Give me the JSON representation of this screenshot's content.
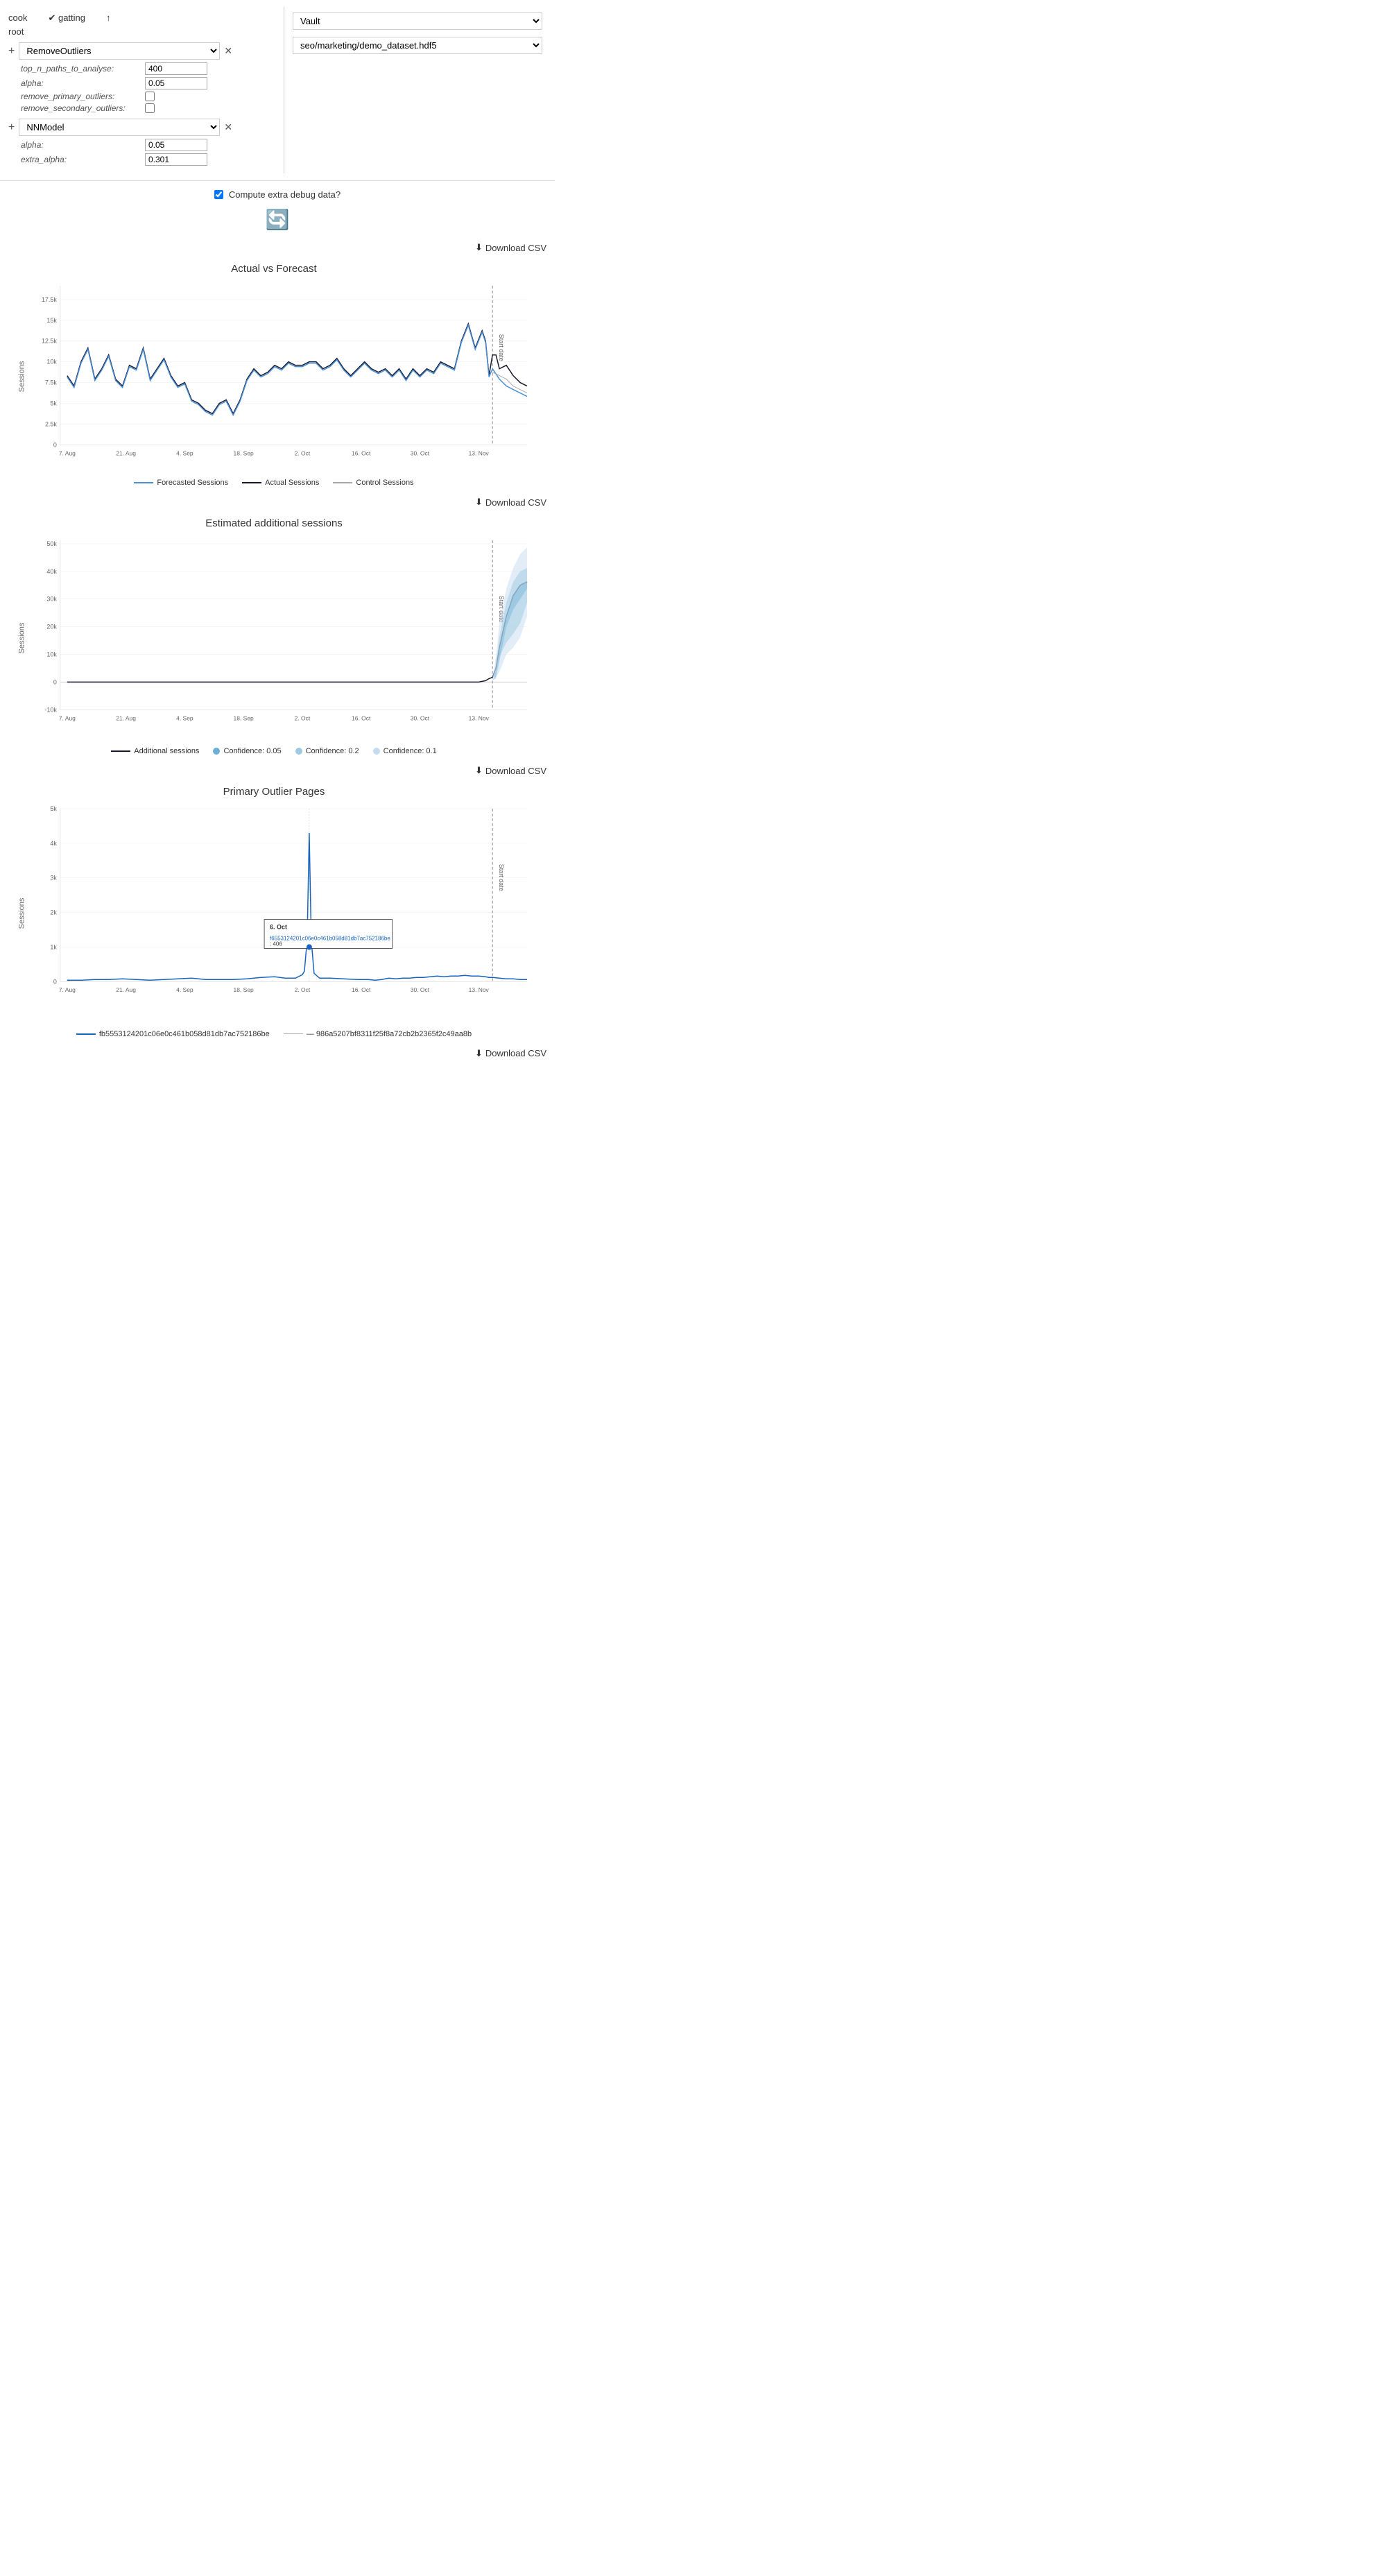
{
  "breadcrumb": {
    "cook": "cook",
    "root": "root",
    "gatting": "✔ gatting",
    "arrow_up": "↑"
  },
  "vault_dropdown": {
    "selected": "Vault",
    "options": [
      "Vault"
    ]
  },
  "dataset_dropdown": {
    "selected": "seo/marketing/demo_dataset.hdf5",
    "options": [
      "seo/marketing/demo_dataset.hdf5"
    ]
  },
  "plugins": [
    {
      "id": "plugin1",
      "name": "RemoveOutliers",
      "params": [
        {
          "label": "top_n_paths_to_analyse:",
          "type": "text",
          "value": "400"
        },
        {
          "label": "alpha:",
          "type": "text",
          "value": "0.05"
        },
        {
          "label": "remove_primary_outliers:",
          "type": "checkbox",
          "value": false
        },
        {
          "label": "remove_secondary_outliers:",
          "type": "checkbox",
          "value": false
        }
      ]
    },
    {
      "id": "plugin2",
      "name": "NNModel",
      "params": [
        {
          "label": "alpha:",
          "type": "text",
          "value": "0.05"
        },
        {
          "label": "extra_alpha:",
          "type": "text",
          "value": "0.301"
        }
      ]
    }
  ],
  "compute": {
    "checkbox_checked": true,
    "label": "Compute extra debug data?"
  },
  "download_csv": "⬇ Download CSV",
  "charts": {
    "actual_vs_forecast": {
      "title": "Actual vs Forecast",
      "y_label": "Sessions",
      "y_ticks": [
        "0",
        "2.5k",
        "5k",
        "7.5k",
        "10k",
        "12.5k",
        "15k",
        "17.5k"
      ],
      "x_ticks": [
        "7. Aug",
        "21. Aug",
        "4. Sep",
        "18. Sep",
        "2. Oct",
        "16. Oct",
        "30. Oct",
        "13. Nov"
      ],
      "legend": [
        {
          "label": "Forecasted Sessions",
          "color": "#4a90d9",
          "type": "line"
        },
        {
          "label": "Actual Sessions",
          "color": "#1a1a2e",
          "type": "line"
        },
        {
          "label": "Control Sessions",
          "color": "#aaa",
          "type": "line"
        }
      ],
      "start_date_label": "Start date"
    },
    "estimated_additional": {
      "title": "Estimated additional sessions",
      "y_label": "Sessions",
      "y_ticks": [
        "-10k",
        "0",
        "10k",
        "20k",
        "30k",
        "40k",
        "50k"
      ],
      "x_ticks": [
        "7. Aug",
        "21. Aug",
        "4. Sep",
        "18. Sep",
        "2. Oct",
        "16. Oct",
        "30. Oct",
        "13. Nov"
      ],
      "legend": [
        {
          "label": "Additional sessions",
          "color": "#1a1a2e",
          "type": "line"
        },
        {
          "label": "Confidence: 0.05",
          "color": "#6baed6",
          "type": "dot"
        },
        {
          "label": "Confidence: 0.2",
          "color": "#9ecae1",
          "type": "dot"
        },
        {
          "label": "Confidence: 0.1",
          "color": "#c6dbef",
          "type": "dot"
        }
      ],
      "start_date_label": "Start date"
    },
    "primary_outlier": {
      "title": "Primary Outlier Pages",
      "y_label": "Sessions",
      "y_ticks": [
        "0",
        "1k",
        "2k",
        "3k",
        "4k",
        "5k"
      ],
      "x_ticks": [
        "7. Aug",
        "21. Aug",
        "4. Sep",
        "18. Sep",
        "2. Oct",
        "16. Oct",
        "30. Oct",
        "13. Nov"
      ],
      "tooltip": {
        "date": "6. Oct",
        "key": "f6553124201c06e0c461b058d81db7ac752186be",
        "value": ": 406"
      },
      "legend": [
        {
          "label": "fb5553124201c06e0c461b058d81db7ac752186be",
          "color": "#1565c0",
          "type": "line"
        },
        {
          "label": "986a5207bf8311f25f8a72cb2b2365f2c49aa8b",
          "color": "#aaa",
          "type": "dashed"
        }
      ],
      "start_date_label": "Start date"
    }
  }
}
